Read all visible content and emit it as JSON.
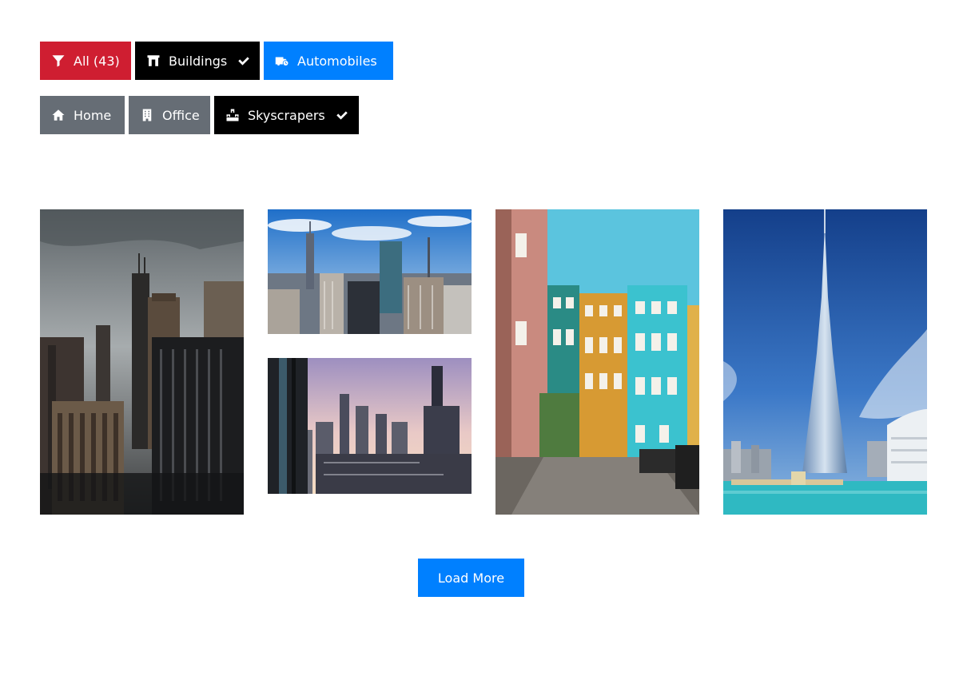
{
  "filters": {
    "row1": [
      {
        "id": "all",
        "label": "All (43)",
        "icon": "filter-icon",
        "checked": false,
        "color": "#cf1e31"
      },
      {
        "id": "buildings",
        "label": "Buildings",
        "icon": "building-gate-icon",
        "checked": true,
        "color": "#000000"
      },
      {
        "id": "automobiles",
        "label": "Automobiles",
        "icon": "truck-clock-icon",
        "checked": false,
        "color": "#0080ff"
      }
    ],
    "row2": [
      {
        "id": "home",
        "label": "Home",
        "icon": "home-icon",
        "checked": false,
        "color": "#666d75"
      },
      {
        "id": "office",
        "label": "Office",
        "icon": "office-building-icon",
        "checked": false,
        "color": "#666d75"
      },
      {
        "id": "skyscrapers",
        "label": "Skyscrapers",
        "icon": "skyscrapers-icon",
        "checked": true,
        "color": "#000000"
      }
    ]
  },
  "gallery": {
    "items": [
      {
        "subject": "dark city skyline with skyscrapers under cloudy sky"
      },
      {
        "subject": "manhattan skyline with empire state building and blue sky"
      },
      {
        "subject": "city skyline at sunset seen from window"
      },
      {
        "subject": "colorful old row houses on cobbled street"
      },
      {
        "subject": "burj khalifa tower with fountain and bridge"
      }
    ]
  },
  "load_more": {
    "label": "Load More",
    "color": "#0080ff"
  }
}
